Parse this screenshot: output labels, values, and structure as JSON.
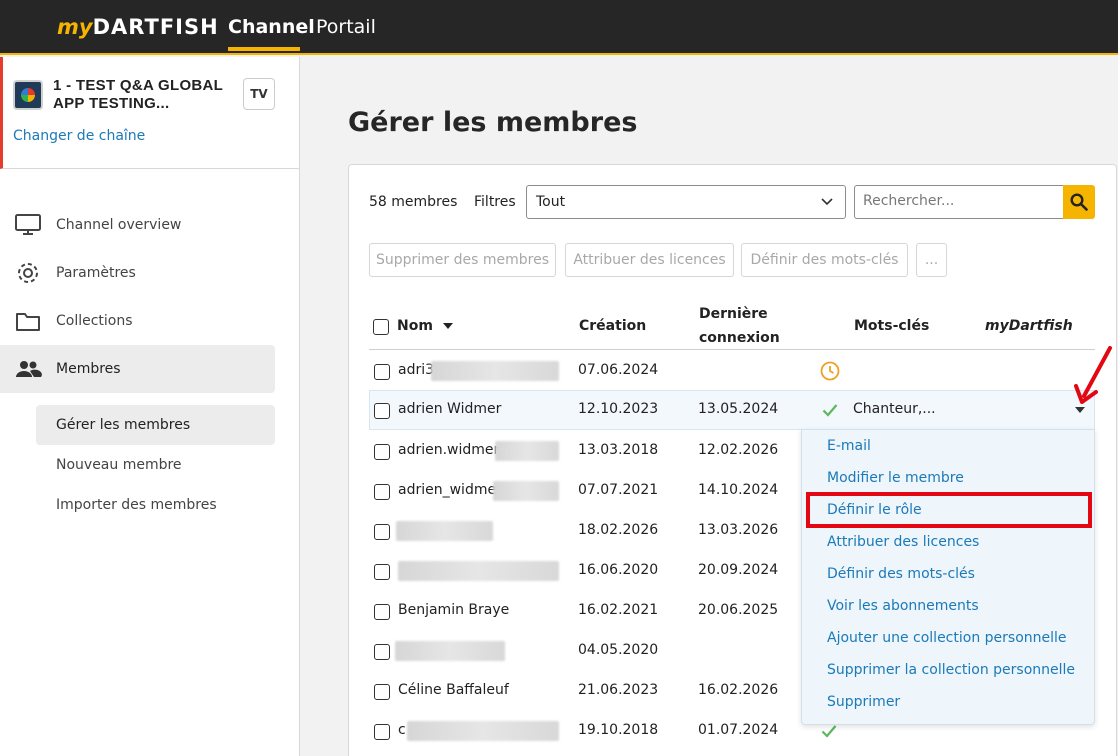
{
  "topbar": {
    "logo_my": "my",
    "logo_rest": "DARTFISH",
    "nav": [
      "Channel",
      "Portail"
    ]
  },
  "sidebar": {
    "channel_name": "1 - TEST Q&A GLOBAL APP TESTING...",
    "channel_badge": "TV",
    "change_channel": "Changer de chaîne",
    "items": [
      {
        "label": "Channel overview",
        "icon": "monitor-icon"
      },
      {
        "label": "Paramètres",
        "icon": "gear-icon"
      },
      {
        "label": "Collections",
        "icon": "folder-icon"
      },
      {
        "label": "Membres",
        "icon": "people-icon"
      }
    ],
    "subitems": [
      "Gérer les membres",
      "Nouveau membre",
      "Importer des membres"
    ]
  },
  "main": {
    "title": "Gérer les membres",
    "member_count": "58  membres",
    "filters_label": "Filtres",
    "filter_value": "Tout",
    "search_placeholder": "Rechercher...",
    "actions": [
      "Supprimer des membres",
      "Attribuer des licences",
      "Définir des mots-clés",
      "..."
    ],
    "columns": {
      "name": "Nom",
      "created": "Création",
      "last_login_1": "Dernière",
      "last_login_2": "connexion",
      "keywords": "Mots-clés",
      "mydartfish": "myDartfish"
    },
    "rows": [
      {
        "name": "adri3",
        "created": "07.06.2024",
        "last": "",
        "keyword": "",
        "status": "pending"
      },
      {
        "name": "adrien Widmer",
        "created": "12.10.2023",
        "last": "13.05.2024",
        "keyword": "Chanteur,...",
        "status": "ok"
      },
      {
        "name": "adrien.widmer",
        "created": "13.03.2018",
        "last": "12.02.2026",
        "keyword": "",
        "status": ""
      },
      {
        "name": "adrien_widme",
        "created": "07.07.2021",
        "last": "14.10.2024",
        "keyword": "",
        "status": ""
      },
      {
        "name": "",
        "created": "18.02.2026",
        "last": "13.03.2026",
        "keyword": "",
        "status": ""
      },
      {
        "name": "",
        "created": "16.06.2020",
        "last": "20.09.2024",
        "keyword": "",
        "status": ""
      },
      {
        "name": "Benjamin Braye",
        "created": "16.02.2021",
        "last": "20.06.2025",
        "keyword": "",
        "status": ""
      },
      {
        "name": "",
        "created": "04.05.2020",
        "last": "",
        "keyword": "",
        "status": ""
      },
      {
        "name": "Céline Baffaleuf",
        "created": "21.06.2023",
        "last": "16.02.2026",
        "keyword": "",
        "status": ""
      },
      {
        "name": "c",
        "created": "19.10.2018",
        "last": "01.07.2024",
        "keyword": "",
        "status": "ok"
      }
    ],
    "menu": [
      "E-mail",
      "Modifier le membre",
      "Définir le rôle",
      "Attribuer des licences",
      "Définir des mots-clés",
      "Voir les abonnements",
      "Ajouter une collection personnelle",
      "Supprimer la collection personnelle",
      "Supprimer"
    ]
  },
  "colors": {
    "accent": "#f5b400",
    "link": "#1b7ab8",
    "highlight_box": "#e30613",
    "ok_check": "#5cb85c",
    "pending_clock": "#f0a020"
  }
}
